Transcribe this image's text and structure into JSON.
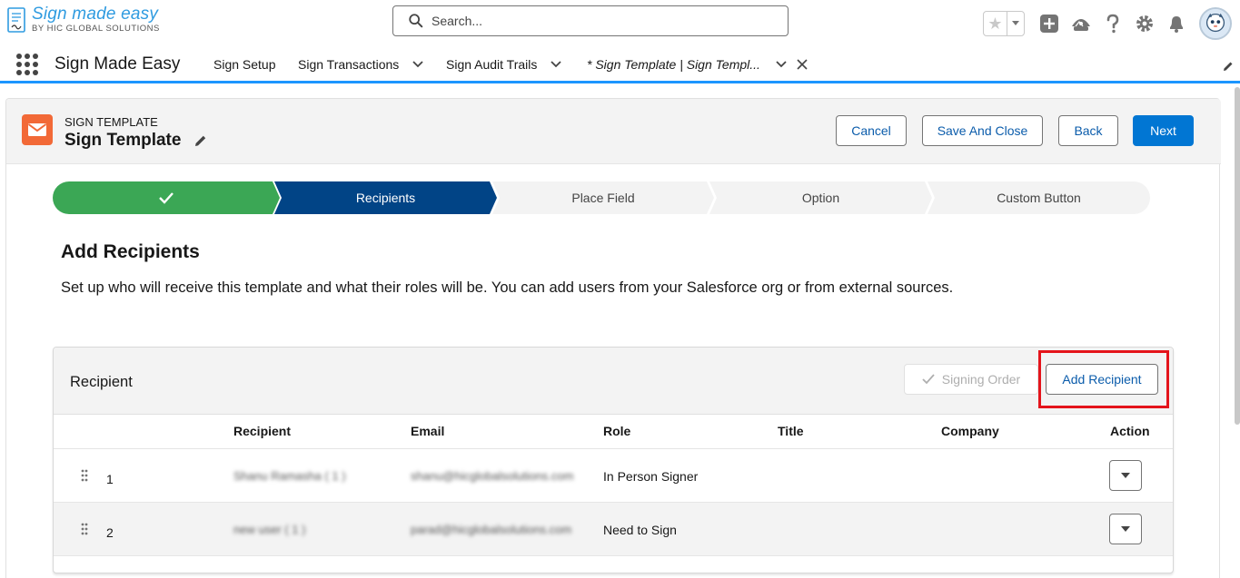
{
  "brand": {
    "title": "Sign made easy",
    "subtitle": "BY HIC GLOBAL SOLUTIONS"
  },
  "search": {
    "placeholder": "Search..."
  },
  "nav": {
    "app_name": "Sign Made Easy",
    "items": [
      {
        "label": "Sign Setup"
      },
      {
        "label": "Sign Transactions"
      },
      {
        "label": "Sign Audit Trails"
      }
    ],
    "active_tab": "* Sign Template | Sign Templ..."
  },
  "page_header": {
    "eyebrow": "SIGN TEMPLATE",
    "title": "Sign Template",
    "buttons": {
      "cancel": "Cancel",
      "save_close": "Save And Close",
      "back": "Back",
      "next": "Next"
    }
  },
  "path": {
    "stages": [
      {
        "label": "",
        "status": "complete"
      },
      {
        "label": "Recipients",
        "status": "current"
      },
      {
        "label": "Place Field",
        "status": "incomplete"
      },
      {
        "label": "Option",
        "status": "incomplete"
      },
      {
        "label": "Custom Button",
        "status": "incomplete"
      }
    ]
  },
  "section": {
    "title": "Add Recipients",
    "description": "Set up who will receive this template and what their roles will be. You can add users from your Salesforce org or from external sources."
  },
  "card": {
    "title": "Recipient",
    "signing_order": "Signing Order",
    "add_recipient": "Add Recipient",
    "columns": [
      "Recipient",
      "Email",
      "Role",
      "Title",
      "Company",
      "Action"
    ],
    "rows": [
      {
        "num": "1",
        "recipient": "Shanu Ramasha ( 1 )",
        "email": "shanu@hicglobalsolutions.com",
        "role": "In Person Signer",
        "title": "",
        "company": ""
      },
      {
        "num": "2",
        "recipient": "new user ( 1 )",
        "email": "parad@hicglobalsolutions.com",
        "role": "Need to Sign",
        "title": "",
        "company": ""
      }
    ]
  },
  "colors": {
    "brand_blue": "#0176d3",
    "path_complete": "#3ba755",
    "path_current": "#014486",
    "path_incomplete": "#f3f3f3",
    "highlight": "#e4141b",
    "template_icon": "#f26937"
  },
  "icons": [
    "search-icon",
    "star-icon",
    "plus-icon",
    "trailhead-icon",
    "help-icon",
    "gear-icon",
    "bell-icon",
    "avatar",
    "waffle-icon",
    "chevron-down-icon",
    "close-icon",
    "pencil-icon",
    "email-icon",
    "check-icon",
    "drag-handle-icon"
  ]
}
